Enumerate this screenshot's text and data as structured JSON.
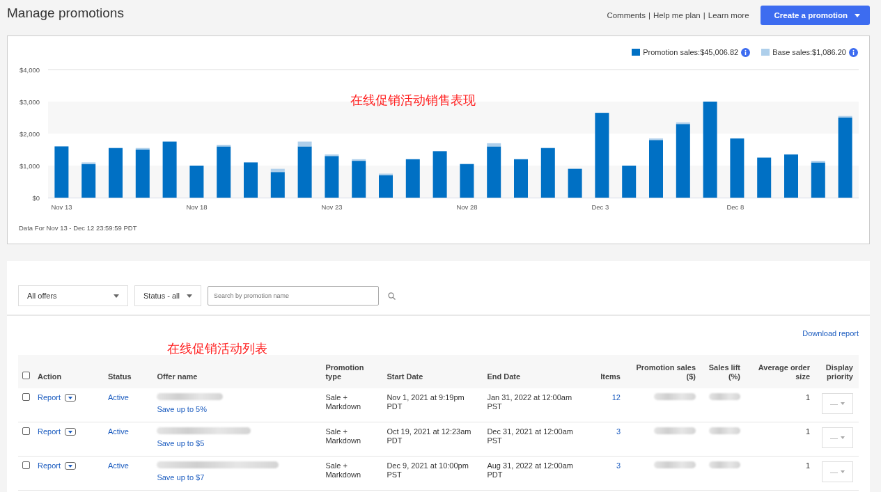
{
  "page": {
    "title": "Manage promotions",
    "links": [
      "Comments",
      "Help me plan",
      "Learn more"
    ],
    "link_separator": "|",
    "create_button": "Create a promotion"
  },
  "chart_panel": {
    "legend_separator": ":",
    "legend_totals": [
      "$45,006.82",
      "$1,086.20"
    ],
    "annotation": "在线促销活动销售表现",
    "chart_data": {
      "type": "bar",
      "stacked": true,
      "categories": [
        "Nov 13",
        null,
        null,
        null,
        null,
        "Nov 18",
        null,
        null,
        null,
        null,
        "Nov 23",
        null,
        null,
        null,
        null,
        "Nov 28",
        null,
        null,
        null,
        null,
        "Dec 3",
        null,
        null,
        null,
        null,
        "Dec 8",
        null,
        null,
        null,
        null
      ],
      "series": [
        {
          "name": "Promotion sales",
          "color": "#0070c4",
          "values": [
            1600,
            1050,
            1550,
            1500,
            1750,
            1000,
            1600,
            1100,
            800,
            1600,
            1300,
            1150,
            700,
            1200,
            1450,
            1050,
            1600,
            1200,
            1550,
            900,
            2650,
            1000,
            1800,
            2300,
            3000,
            1850,
            1250,
            1350,
            1100,
            2500
          ]
        },
        {
          "name": "Base sales",
          "color": "#aecfeb",
          "values": [
            0,
            50,
            0,
            50,
            0,
            0,
            50,
            0,
            100,
            150,
            50,
            50,
            50,
            0,
            0,
            0,
            100,
            0,
            0,
            0,
            0,
            0,
            50,
            50,
            0,
            0,
            0,
            0,
            50,
            50
          ]
        }
      ],
      "ylim": [
        0,
        4000
      ],
      "yticks": [
        {
          "value": 0,
          "label": "$0"
        },
        {
          "value": 1000,
          "label": "$1,000"
        },
        {
          "value": 2000,
          "label": "$2,000"
        },
        {
          "value": 3000,
          "label": "$3,000"
        },
        {
          "value": 4000,
          "label": "$4,000"
        }
      ]
    },
    "footnote": "Data For Nov 13 - Dec 12 23:59:59 PDT"
  },
  "filters": {
    "offers": "All offers",
    "status": "Status - all",
    "search_placeholder": "Search by promotion name"
  },
  "download_link": "Download report",
  "table_annotation": "在线促销活动列表",
  "table": {
    "columns": [
      "Action",
      "Status",
      "Offer name",
      "Promotion type",
      "Start Date",
      "End Date",
      "Items",
      "Promotion sales ($)",
      "Sales lift (%)",
      "Average order size",
      "Display priority"
    ],
    "select_all_checked": false,
    "rows": [
      {
        "checked": false,
        "action": "Report",
        "status": "Active",
        "offer_subtitle": "Save up to 5%",
        "type": "Sale + Markdown",
        "start": "Nov 1, 2021 at 9:19pm PDT",
        "end": "Jan 31, 2022 at 12:00am PST",
        "items": "12",
        "avg_order": "1",
        "priority": "—"
      },
      {
        "checked": false,
        "action": "Report",
        "status": "Active",
        "offer_subtitle": "Save up to $5",
        "type": "Sale + Markdown",
        "start": "Oct 19, 2021 at 12:23am PDT",
        "end": "Dec 31, 2021 at 12:00am PST",
        "items": "3",
        "avg_order": "1",
        "priority": "—"
      },
      {
        "checked": false,
        "action": "Report",
        "status": "Active",
        "offer_subtitle": "Save up to $7",
        "type": "Sale + Markdown",
        "start": "Dec 9, 2021 at 10:00pm PST",
        "end": "Aug 31, 2022 at 12:00am PDT",
        "items": "3",
        "avg_order": "1",
        "priority": "—"
      }
    ]
  }
}
